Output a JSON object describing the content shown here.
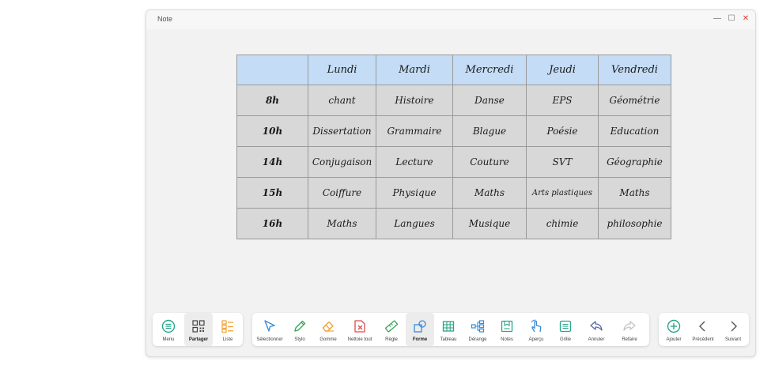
{
  "window": {
    "title": "Note"
  },
  "table": {
    "header": [
      "",
      "Lundi",
      "Mardi",
      "Mercredi",
      "Jeudi",
      "Vendredi"
    ],
    "rows": [
      [
        "8h",
        "chant",
        "Histoire",
        "Danse",
        "EPS",
        "Géométrie"
      ],
      [
        "10h",
        "Dissertation",
        "Grammaire",
        "Blague",
        "Poésie",
        "Education"
      ],
      [
        "14h",
        "Conjugaison",
        "Lecture",
        "Couture",
        "SVT",
        "Géographie"
      ],
      [
        "15h",
        "Coiffure",
        "Physique",
        "Maths",
        "Arts plastiques",
        "Maths"
      ],
      [
        "16h",
        "Maths",
        "Langues",
        "Musique",
        "chimie",
        "philosophie"
      ]
    ]
  },
  "toolbar": {
    "left": [
      {
        "label": "Menu",
        "icon": "menu-icon"
      },
      {
        "label": "Partager",
        "icon": "share-grid-icon"
      },
      {
        "label": "Liste",
        "icon": "list-icon"
      }
    ],
    "tools": [
      {
        "label": "Sélectionner",
        "icon": "cursor-icon"
      },
      {
        "label": "Stylo",
        "icon": "pen-icon"
      },
      {
        "label": "Gomme",
        "icon": "eraser-icon"
      },
      {
        "label": "Nettoie tout",
        "icon": "clear-all-icon"
      },
      {
        "label": "Règle",
        "icon": "ruler-icon"
      },
      {
        "label": "Forme",
        "icon": "shapes-icon"
      },
      {
        "label": "Tableau",
        "icon": "table-icon"
      },
      {
        "label": "Dérange",
        "icon": "mindmap-icon"
      },
      {
        "label": "Notes",
        "icon": "notes-icon"
      },
      {
        "label": "Aperçu",
        "icon": "hand-pointer-icon"
      },
      {
        "label": "Grille",
        "icon": "grid-icon"
      },
      {
        "label": "Annuler",
        "icon": "undo-icon"
      },
      {
        "label": "Refaire",
        "icon": "redo-icon"
      }
    ],
    "right": [
      {
        "label": "Ajouter",
        "icon": "add-icon"
      },
      {
        "label": "Précédent",
        "icon": "chevron-left-icon"
      },
      {
        "label": "Suivant",
        "icon": "chevron-right-icon"
      }
    ]
  },
  "colors": {
    "accent": "#2aa58a",
    "header_bg": "#c4dcf5",
    "cell_bg": "#d8d8d8",
    "pen": "#3aa55a",
    "eraser": "#f0a030",
    "clear": "#e04a4a",
    "undo": "#5a6aa0"
  }
}
